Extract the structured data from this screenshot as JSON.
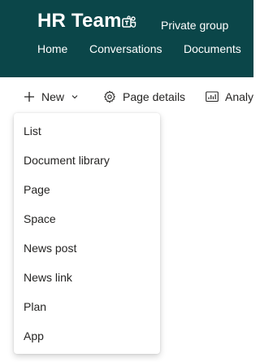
{
  "header": {
    "site_title": "HR Team",
    "privacy_label": "Private group",
    "nav_items": [
      "Home",
      "Conversations",
      "Documents"
    ]
  },
  "commandbar": {
    "new_label": "New",
    "page_details_label": "Page details",
    "analytics_label": "Analytics"
  },
  "new_menu": {
    "items": [
      "List",
      "Document library",
      "Page",
      "Space",
      "News post",
      "News link",
      "Plan",
      "App"
    ]
  },
  "colors": {
    "header_bg": "#0b4649",
    "text": "#252423"
  },
  "icons": {
    "teams": "teams-icon",
    "new": "plus-icon",
    "dropdown": "chevron-down-icon",
    "page_details": "gear-icon",
    "analytics": "analytics-icon"
  }
}
